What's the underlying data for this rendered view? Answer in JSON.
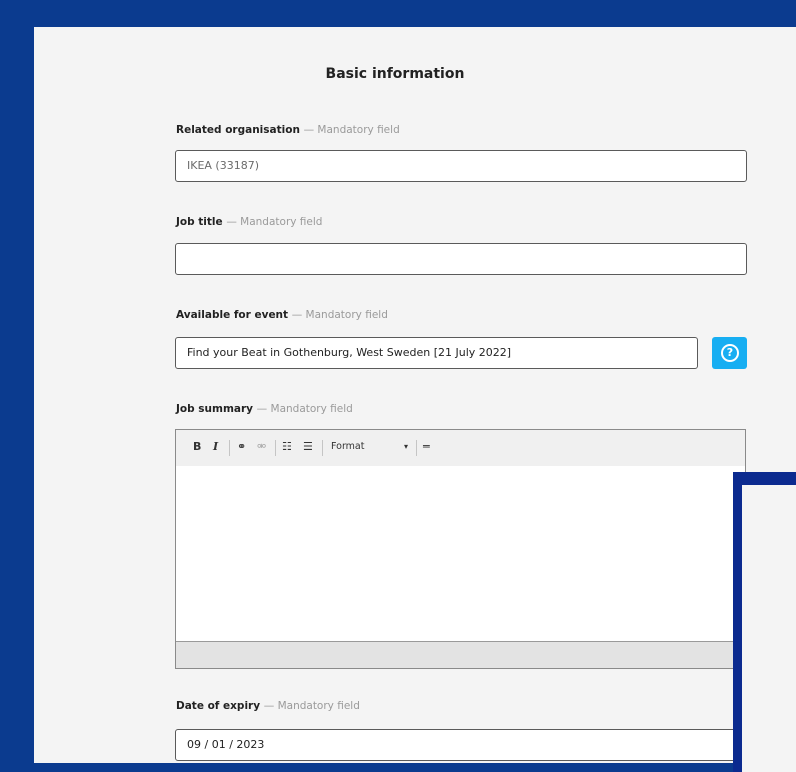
{
  "section": {
    "title": "Basic information"
  },
  "fields": {
    "organisation": {
      "label": "Related organisation",
      "required": "— Mandatory field",
      "value": "IKEA (33187)"
    },
    "job_title": {
      "label": "Job title",
      "required": "— Mandatory field",
      "value": ""
    },
    "event": {
      "label": "Available for event",
      "required": "— Mandatory field",
      "value": "Find your Beat in Gothenburg, West Sweden [21 July 2022]",
      "help_icon": "question-circle-icon"
    },
    "summary": {
      "label": "Job summary",
      "required": "— Mandatory field",
      "toolbar": {
        "bold": "B",
        "italic": "I",
        "link": "⚭",
        "unlink": "⚮",
        "bullets": "☷",
        "numbers": "☰",
        "format": "Format",
        "format_caret": "▾",
        "hr": "═"
      }
    },
    "expiry": {
      "label": "Date of expiry",
      "required": "— Mandatory field",
      "value": "09 / 01 / 2023"
    }
  },
  "colors": {
    "frame": "#0b3b8f",
    "help_button": "#17aef2",
    "panel": "#f4f4f4"
  }
}
